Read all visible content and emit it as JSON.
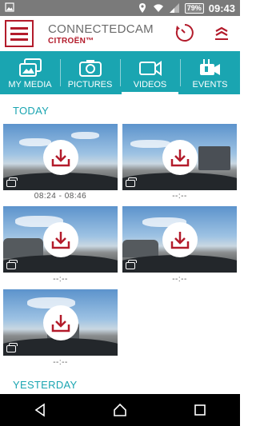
{
  "status_bar": {
    "battery": "79%",
    "time": "09:43"
  },
  "header": {
    "title": "CONNECTEDCAM",
    "subtitle": "CITROËN™",
    "accent_color": "#b31b2b"
  },
  "tabs": [
    {
      "label": "MY MEDIA",
      "icon": "my-media-icon",
      "active": false
    },
    {
      "label": "PICTURES",
      "icon": "camera-icon",
      "active": false
    },
    {
      "label": "VIDEOS",
      "icon": "video-camera-icon",
      "active": true
    },
    {
      "label": "EVENTS",
      "icon": "event-video-icon",
      "active": false
    }
  ],
  "tab_color": "#1aa5b1",
  "sections": [
    {
      "title": "TODAY",
      "items": [
        {
          "caption": "08:24 - 08:46"
        },
        {
          "caption": "--:--"
        },
        {
          "caption": "--:--"
        },
        {
          "caption": "--:--"
        },
        {
          "caption": "--:--"
        }
      ]
    },
    {
      "title": "YESTERDAY",
      "items": []
    }
  ]
}
